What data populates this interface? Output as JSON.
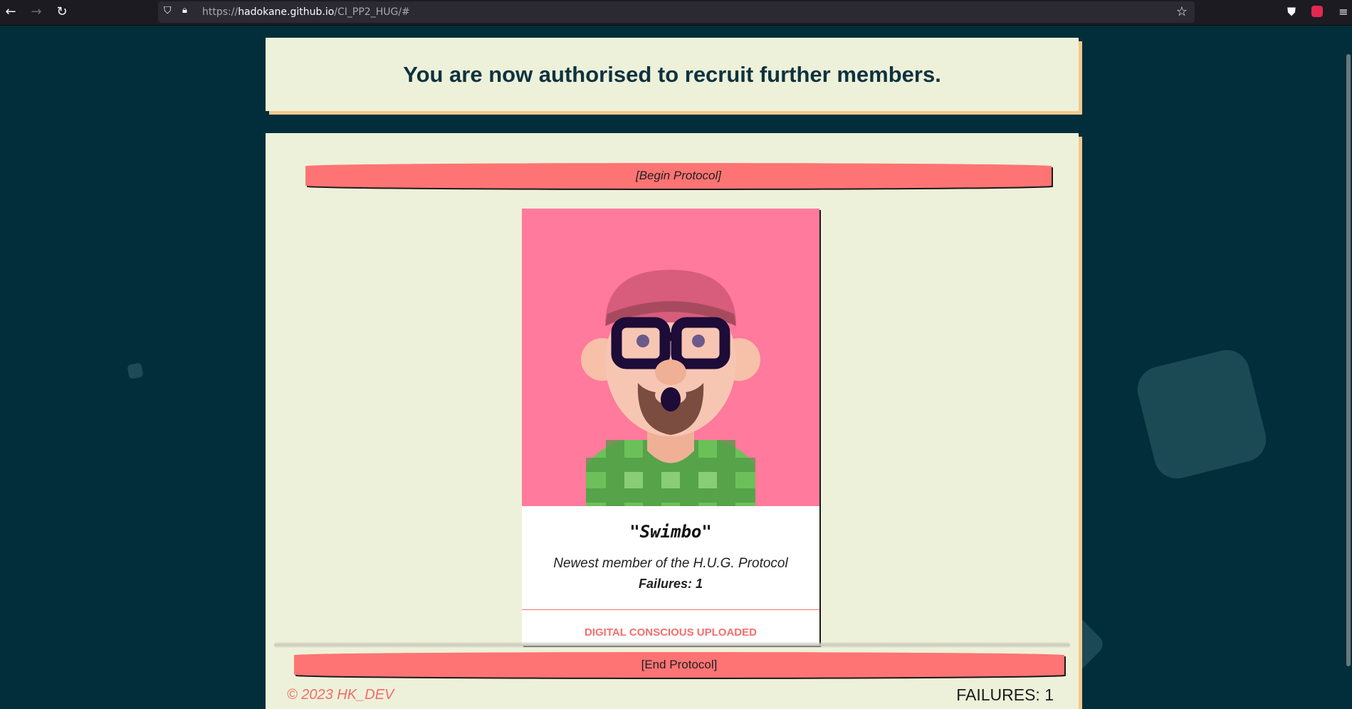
{
  "browser": {
    "url_prefix": "https://",
    "url_host": "hadokane.github.io",
    "url_path": "/CI_PP2_HUG/#",
    "back_icon": "arrow-left-icon",
    "forward_icon": "arrow-right-icon",
    "reload_icon": "reload-icon"
  },
  "header": {
    "title": "You are now authorised to recruit further members."
  },
  "protocol": {
    "begin_label": "[Begin Protocol]",
    "end_label": "[End Protocol]"
  },
  "card": {
    "name": "\"Swimbo\"",
    "subtitle": "Newest member of the H.U.G. Protocol",
    "failures": "Failures: 1",
    "status": "DIGITAL CONSCIOUS UPLOADED"
  },
  "footer": {
    "copyright": "© 2023 HK_DEV",
    "failures": "FAILURES: 1"
  },
  "colors": {
    "background": "#012e3a",
    "panel": "#eef1d9",
    "accent": "#fe7474",
    "card_image_bg": "#ff7a9c"
  }
}
